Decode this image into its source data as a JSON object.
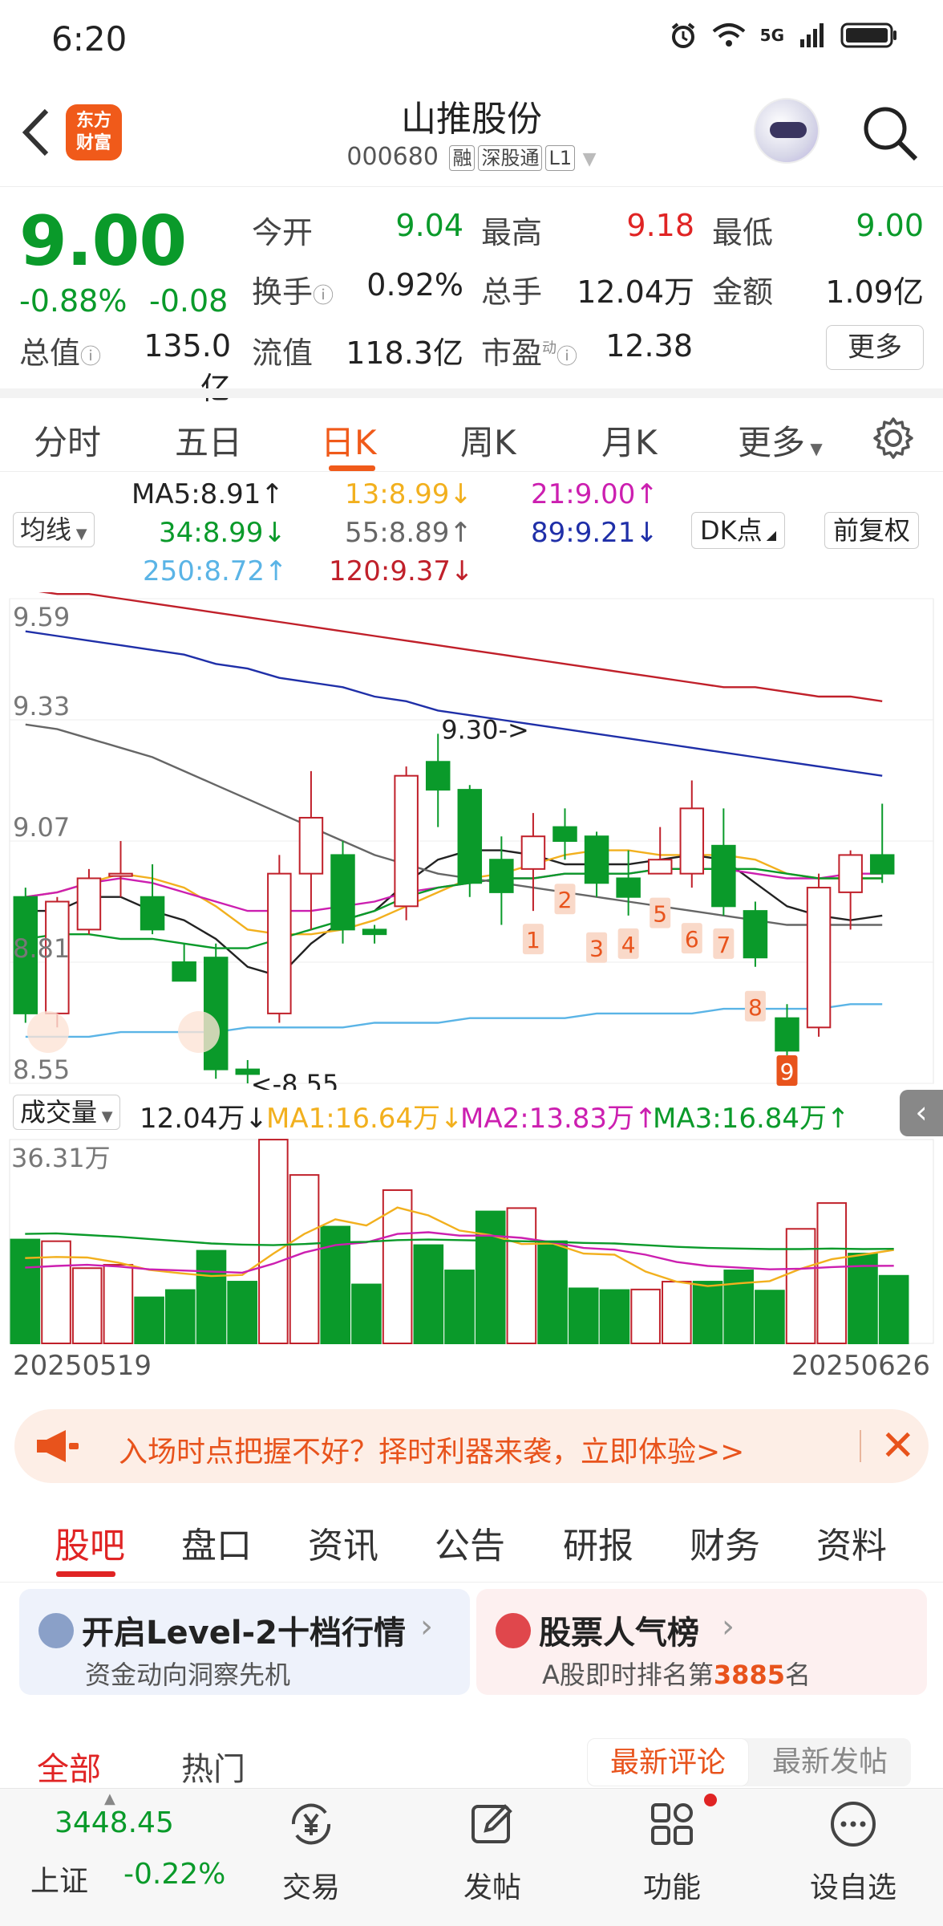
{
  "status": {
    "time": "6:20",
    "network": "5G"
  },
  "header": {
    "back_label": "<",
    "logo_line1": "东方",
    "logo_line2": "财富",
    "stock_name": "山推股份",
    "stock_code": "000680",
    "tags": [
      "融",
      "深股通",
      "L1"
    ]
  },
  "quote": {
    "price": "9.00",
    "pct": "-0.88%",
    "change": "-0.08",
    "open_label": "今开",
    "open": "9.04",
    "high_label": "最高",
    "high": "9.18",
    "low_label": "最低",
    "low": "9.00",
    "turnover_label": "换手",
    "turnover": "0.92%",
    "volume_label": "总手",
    "volume": "12.04万",
    "amount_label": "金额",
    "amount": "1.09亿",
    "mktcap_label": "总值",
    "mktcap": "135.0亿",
    "float_label": "流值",
    "float": "118.3亿",
    "pe_label": "市盈",
    "pe_sup": "动",
    "pe": "12.38",
    "more_label": "更多"
  },
  "period_tabs": [
    "分时",
    "五日",
    "日K",
    "周K",
    "月K",
    "更多"
  ],
  "ma_legend": {
    "select_label": "均线",
    "ma5": "MA5:8.91↑",
    "ma13": "13:8.99↓",
    "ma21": "21:9.00↑",
    "ma34": "34:8.99↓",
    "ma55": "55:8.89↑",
    "ma89": "89:9.21↓",
    "ma250": "250:8.72↑",
    "ma120": "120:9.37↓",
    "dk_label": "DK点",
    "adjust_label": "前复权",
    "colors": {
      "ma5": "#222222",
      "ma13": "#f2b01e",
      "ma21": "#cc1fb0",
      "ma34": "#0a9a2a",
      "ma55": "#666666",
      "ma89": "#1f2fa8",
      "ma250": "#5ab4e6",
      "ma120": "#c0202a"
    }
  },
  "chart_data": [
    {
      "type": "candlestick",
      "title": "",
      "y_ticks": [
        "9.59",
        "9.33",
        "9.07",
        "8.81",
        "8.55"
      ],
      "ylim": [
        8.55,
        9.59
      ],
      "annotations": {
        "high_marker": "9.30->",
        "low_marker": "<-8.55"
      },
      "dk_markers": [
        "1",
        "2",
        "3",
        "4",
        "5",
        "6",
        "7",
        "8",
        "9"
      ],
      "candles": [
        {
          "o": 8.95,
          "h": 8.97,
          "c": 8.7,
          "l": 8.68
        },
        {
          "o": 8.7,
          "h": 8.95,
          "c": 8.94,
          "l": 8.67
        },
        {
          "o": 8.88,
          "h": 9.01,
          "c": 8.99,
          "l": 8.87
        },
        {
          "o": 9.0,
          "h": 9.07,
          "c": 9.0,
          "l": 8.95
        },
        {
          "o": 8.95,
          "h": 9.02,
          "c": 8.88,
          "l": 8.87
        },
        {
          "o": 8.81,
          "h": 8.85,
          "c": 8.77,
          "l": 8.77
        },
        {
          "o": 8.82,
          "h": 8.85,
          "c": 8.58,
          "l": 8.56
        },
        {
          "o": 8.58,
          "h": 8.6,
          "c": 8.57,
          "l": 8.55
        },
        {
          "o": 8.7,
          "h": 9.04,
          "c": 9.0,
          "l": 8.68
        },
        {
          "o": 9.0,
          "h": 9.22,
          "c": 9.12,
          "l": 8.88
        },
        {
          "o": 9.04,
          "h": 9.07,
          "c": 8.88,
          "l": 8.85
        },
        {
          "o": 8.88,
          "h": 8.89,
          "c": 8.87,
          "l": 8.85
        },
        {
          "o": 8.93,
          "h": 9.23,
          "c": 9.21,
          "l": 8.9
        },
        {
          "o": 9.24,
          "h": 9.3,
          "c": 9.18,
          "l": 9.1
        },
        {
          "o": 9.18,
          "h": 9.19,
          "c": 8.98,
          "l": 8.95
        },
        {
          "o": 9.03,
          "h": 9.08,
          "c": 8.96,
          "l": 8.89
        },
        {
          "o": 9.01,
          "h": 9.13,
          "c": 9.08,
          "l": 8.92
        },
        {
          "o": 9.1,
          "h": 9.14,
          "c": 9.07,
          "l": 9.03
        },
        {
          "o": 9.08,
          "h": 9.09,
          "c": 8.98,
          "l": 8.95
        },
        {
          "o": 8.99,
          "h": 9.05,
          "c": 8.95,
          "l": 8.91
        },
        {
          "o": 9.0,
          "h": 9.1,
          "c": 9.03,
          "l": 9.0
        },
        {
          "o": 9.0,
          "h": 9.2,
          "c": 9.14,
          "l": 8.97
        },
        {
          "o": 9.06,
          "h": 9.14,
          "c": 8.93,
          "l": 8.91
        },
        {
          "o": 8.92,
          "h": 8.94,
          "c": 8.82,
          "l": 8.8
        },
        {
          "o": 8.69,
          "h": 8.72,
          "c": 8.62,
          "l": 8.6
        },
        {
          "o": 8.67,
          "h": 9.0,
          "c": 8.97,
          "l": 8.65
        },
        {
          "o": 8.96,
          "h": 9.05,
          "c": 9.04,
          "l": 8.88
        },
        {
          "o": 9.04,
          "h": 9.15,
          "c": 9.0,
          "l": 8.98
        }
      ],
      "ma_series": [
        {
          "name": "MA5",
          "values": [
            8.92,
            8.92,
            8.95,
            8.95,
            8.92,
            8.9,
            8.86,
            8.8,
            8.78,
            8.85,
            8.9,
            8.92,
            8.98,
            9.03,
            9.05,
            9.05,
            9.04,
            9.02,
            9.02,
            9.02,
            9.03,
            9.04,
            9.03,
            8.98,
            8.93,
            8.91,
            8.9,
            8.91
          ]
        },
        {
          "name": "MA13",
          "values": [
            8.95,
            8.96,
            8.98,
            9.0,
            8.99,
            8.97,
            8.93,
            8.88,
            8.87,
            8.87,
            8.88,
            8.9,
            8.93,
            8.96,
            8.99,
            9.0,
            9.02,
            9.04,
            9.05,
            9.05,
            9.04,
            9.04,
            9.04,
            9.03,
            9.0,
            8.99,
            8.99,
            8.99
          ]
        },
        {
          "name": "MA21",
          "values": [
            8.95,
            8.96,
            8.98,
            8.99,
            8.98,
            8.96,
            8.94,
            8.92,
            8.92,
            8.92,
            8.93,
            8.94,
            8.96,
            8.97,
            8.98,
            8.99,
            8.99,
            9.0,
            9.0,
            9.0,
            9.01,
            9.01,
            9.01,
            9.0,
            8.99,
            8.99,
            9.0,
            9.0
          ]
        },
        {
          "name": "MA34",
          "values": [
            8.86,
            8.87,
            8.87,
            8.86,
            8.86,
            8.85,
            8.84,
            8.84,
            8.86,
            8.88,
            8.9,
            8.92,
            8.95,
            8.97,
            8.98,
            8.99,
            8.99,
            9.0,
            9.0,
            9.0,
            9.01,
            9.01,
            9.01,
            9.01,
            9.0,
            8.99,
            8.99,
            8.99
          ]
        },
        {
          "name": "MA55",
          "values": [
            9.32,
            9.31,
            9.29,
            9.27,
            9.25,
            9.22,
            9.19,
            9.16,
            9.13,
            9.1,
            9.07,
            9.04,
            9.02,
            9.0,
            8.99,
            8.98,
            8.97,
            8.96,
            8.95,
            8.94,
            8.93,
            8.92,
            8.91,
            8.9,
            8.89,
            8.89,
            8.89,
            8.89
          ]
        },
        {
          "name": "MA89",
          "values": [
            9.52,
            9.51,
            9.5,
            9.49,
            9.48,
            9.47,
            9.45,
            9.44,
            9.42,
            9.41,
            9.4,
            9.38,
            9.37,
            9.35,
            9.34,
            9.33,
            9.32,
            9.31,
            9.3,
            9.29,
            9.28,
            9.27,
            9.26,
            9.25,
            9.24,
            9.23,
            9.22,
            9.21
          ]
        },
        {
          "name": "MA120",
          "values": [
            9.61,
            9.6,
            9.6,
            9.59,
            9.58,
            9.57,
            9.56,
            9.55,
            9.54,
            9.53,
            9.52,
            9.51,
            9.5,
            9.49,
            9.48,
            9.47,
            9.46,
            9.45,
            9.44,
            9.43,
            9.42,
            9.41,
            9.4,
            9.4,
            9.39,
            9.38,
            9.38,
            9.37
          ]
        },
        {
          "name": "MA250",
          "values": [
            8.65,
            8.65,
            8.65,
            8.66,
            8.66,
            8.66,
            8.66,
            8.67,
            8.67,
            8.67,
            8.67,
            8.68,
            8.68,
            8.68,
            8.69,
            8.69,
            8.69,
            8.69,
            8.7,
            8.7,
            8.7,
            8.7,
            8.71,
            8.71,
            8.71,
            8.71,
            8.72,
            8.72
          ]
        }
      ]
    },
    {
      "type": "bar",
      "title": "",
      "y_max_label": "36.31万",
      "ylim": [
        0,
        36.31
      ],
      "x_start": "20250519",
      "x_end": "20250626",
      "volumes": [
        18.5,
        18.2,
        13.4,
        14.0,
        8.2,
        9.5,
        16.5,
        11.0,
        36.3,
        30.0,
        20.8,
        10.5,
        27.3,
        17.5,
        13.0,
        23.5,
        24.1,
        18.2,
        9.8,
        9.5,
        9.6,
        11.0,
        11.0,
        13.0,
        9.4,
        20.4,
        25.0,
        16.0,
        12.04
      ],
      "ma_series": [
        {
          "name": "MA1",
          "values": [
            15.2,
            15.4,
            15.3,
            14.4,
            13.1,
            12.5,
            12.0,
            12.2,
            16.0,
            19.5,
            22.1,
            21.0,
            24.2,
            22.8,
            20.1,
            19.3,
            17.7,
            17.8,
            16.0,
            15.8,
            12.8,
            11.0,
            10.2,
            10.7,
            11.1,
            13.3,
            15.0,
            15.8,
            16.64
          ]
        },
        {
          "name": "MA2",
          "values": [
            13.5,
            13.8,
            14.0,
            13.7,
            13.2,
            13.0,
            12.8,
            12.6,
            14.2,
            16.2,
            17.5,
            18.0,
            19.5,
            19.8,
            19.2,
            19.2,
            18.8,
            18.0,
            17.0,
            16.7,
            15.8,
            14.5,
            13.8,
            13.5,
            13.2,
            13.3,
            13.6,
            13.8,
            13.83
          ]
        },
        {
          "name": "MA3",
          "values": [
            19.5,
            19.6,
            19.3,
            19.0,
            18.6,
            18.2,
            17.8,
            17.6,
            17.5,
            17.7,
            18.0,
            18.1,
            18.4,
            18.5,
            18.4,
            18.3,
            18.2,
            18.1,
            17.9,
            17.8,
            17.5,
            17.2,
            17.0,
            16.9,
            16.8,
            16.8,
            16.9,
            16.8,
            16.84
          ]
        }
      ]
    }
  ],
  "volume_legend": {
    "select_label": "成交量",
    "total": "12.04万↓",
    "ma1": "MA1:16.64万↓",
    "ma2": "MA2:13.83万↑",
    "ma3": "MA3:16.84万↑"
  },
  "promo": {
    "text": "入场时点把握不好？择时利器来袭，立即体验>>"
  },
  "content_tabs": [
    "股吧",
    "盘口",
    "资讯",
    "公告",
    "研报",
    "财务",
    "资料"
  ],
  "cards": {
    "level2_title": "开启Level-2十档行情",
    "level2_sub": "资金动向洞察先机",
    "popularity_title": "股票人气榜",
    "popularity_sub_prefix": "A股即时排名第",
    "popularity_rank": "3885",
    "popularity_sub_suffix": "名"
  },
  "feed_tabs": [
    "全部",
    "热门"
  ],
  "sort_options": [
    "最新评论",
    "最新发帖"
  ],
  "bottom_nav": {
    "index_value": "3448.45",
    "index_name": "上证",
    "index_change": "-0.22%",
    "items": [
      "交易",
      "发帖",
      "功能",
      "设自选"
    ]
  }
}
